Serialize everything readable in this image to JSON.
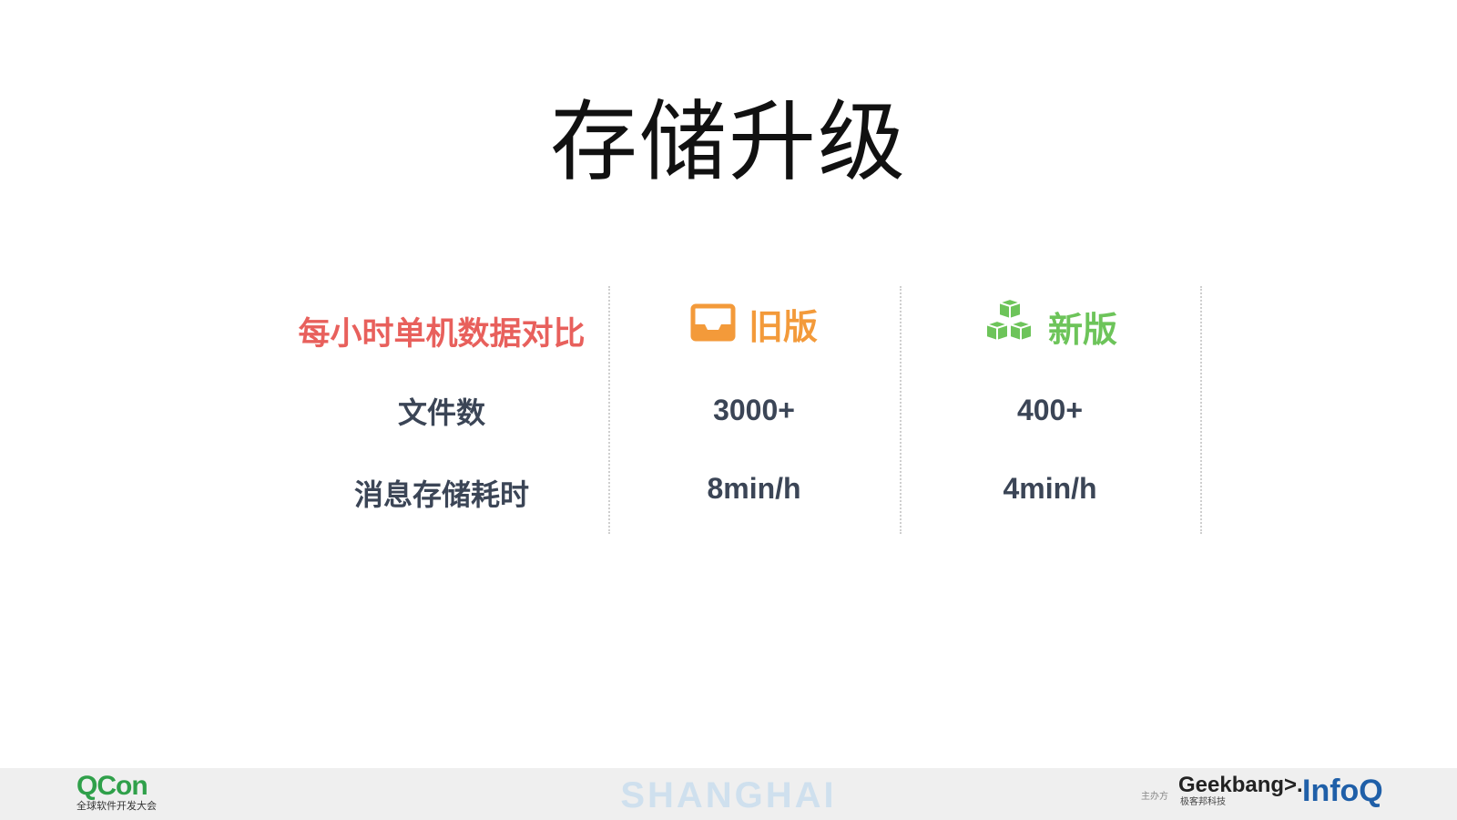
{
  "slide": {
    "title": "存储升级"
  },
  "table": {
    "header_label": "每小时单机数据对比",
    "old_column": {
      "label": "旧版",
      "icon": "inbox-tray-icon",
      "color": "#f39a3a"
    },
    "new_column": {
      "label": "新版",
      "icon": "stacked-cubes-icon",
      "color": "#6dc45a"
    },
    "rows": [
      {
        "label": "文件数",
        "old": "3000+",
        "new": "400+"
      },
      {
        "label": "消息存储耗时",
        "old": "8min/h",
        "new": "4min/h"
      }
    ]
  },
  "footer": {
    "qcon_logo": "QCon",
    "qcon_subtitle": "全球软件开发大会",
    "city": "SHANGHAI",
    "organizer_label": "主办方",
    "geekbang_logo": "Geekbang>.",
    "geekbang_subtitle": "极客邦科技",
    "infoq_logo": "InfoQ"
  }
}
